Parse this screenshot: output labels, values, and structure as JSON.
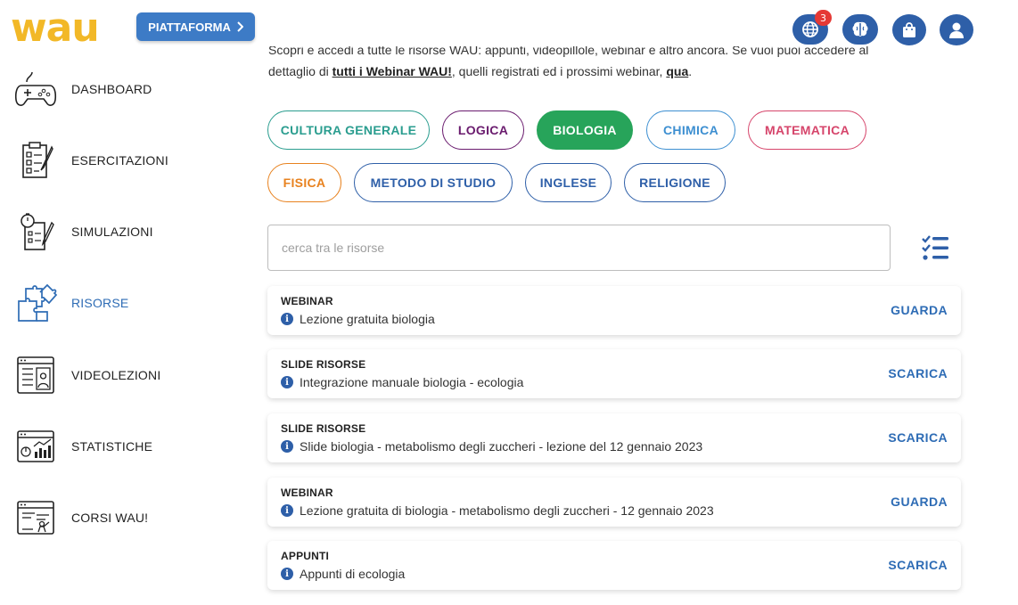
{
  "header": {
    "logo": "wau",
    "platform_label": "PIATTAFORMA",
    "notifications_count": "3",
    "icons": [
      "globe-icon",
      "brain-icon",
      "shopping-bag-icon",
      "user-icon"
    ],
    "accent_color": "#2e5fa8",
    "logo_color": "#f2b827"
  },
  "sidebar": {
    "items": [
      {
        "label": "DASHBOARD",
        "icon": "gamepad-icon"
      },
      {
        "label": "ESERCITAZIONI",
        "icon": "checklist-icon"
      },
      {
        "label": "SIMULAZIONI",
        "icon": "timer-checklist-icon"
      },
      {
        "label": "RISORSE",
        "icon": "puzzle-icon",
        "active": true
      },
      {
        "label": "VIDEOLEZIONI",
        "icon": "video-lesson-icon"
      },
      {
        "label": "STATISTICHE",
        "icon": "statistics-icon"
      },
      {
        "label": "CORSI WAU!",
        "icon": "course-board-icon"
      }
    ]
  },
  "intro": {
    "line1": "Scopri e accedi a tutte le risorse WAU: appunti, videopillole, webinar e altro ancora. Se vuoi puoi accedere al",
    "line2_prefix": "dettaglio di ",
    "line2_link1": "tutti i Webinar WAU!",
    "line2_middle": ", quelli registrati ed i prossimi webinar, ",
    "line2_link2": "qua",
    "line2_suffix": "."
  },
  "categories": [
    {
      "label": "CULTURA GENERALE",
      "color": "#2a9d8f"
    },
    {
      "label": "LOGICA",
      "color": "#6a1b6e"
    },
    {
      "label": "BIOLOGIA",
      "color": "#27a45a",
      "selected": true
    },
    {
      "label": "CHIMICA",
      "color": "#3d8fd1"
    },
    {
      "label": "MATEMATICA",
      "color": "#d6456b"
    },
    {
      "label": "FISICA",
      "color": "#e8821f"
    },
    {
      "label": "METODO DI STUDIO",
      "color": "#2e5fa8"
    },
    {
      "label": "INGLESE",
      "color": "#2e5fa8"
    },
    {
      "label": "RELIGIONE",
      "color": "#2e5fa8"
    }
  ],
  "search": {
    "placeholder": "cerca tra le risorse",
    "value": ""
  },
  "resources": [
    {
      "type": "WEBINAR",
      "title": "Lezione gratuita biologia",
      "action": "GUARDA"
    },
    {
      "type": "SLIDE RISORSE",
      "title": "Integrazione manuale biologia - ecologia",
      "action": "SCARICA"
    },
    {
      "type": "SLIDE RISORSE",
      "title": "Slide biologia - metabolismo degli zuccheri - lezione del 12 gennaio 2023",
      "action": "SCARICA"
    },
    {
      "type": "WEBINAR",
      "title": "Lezione gratuita di biologia - metabolismo degli zuccheri - 12 gennaio 2023",
      "action": "GUARDA"
    },
    {
      "type": "APPUNTI",
      "title": "Appunti di ecologia",
      "action": "SCARICA"
    }
  ]
}
